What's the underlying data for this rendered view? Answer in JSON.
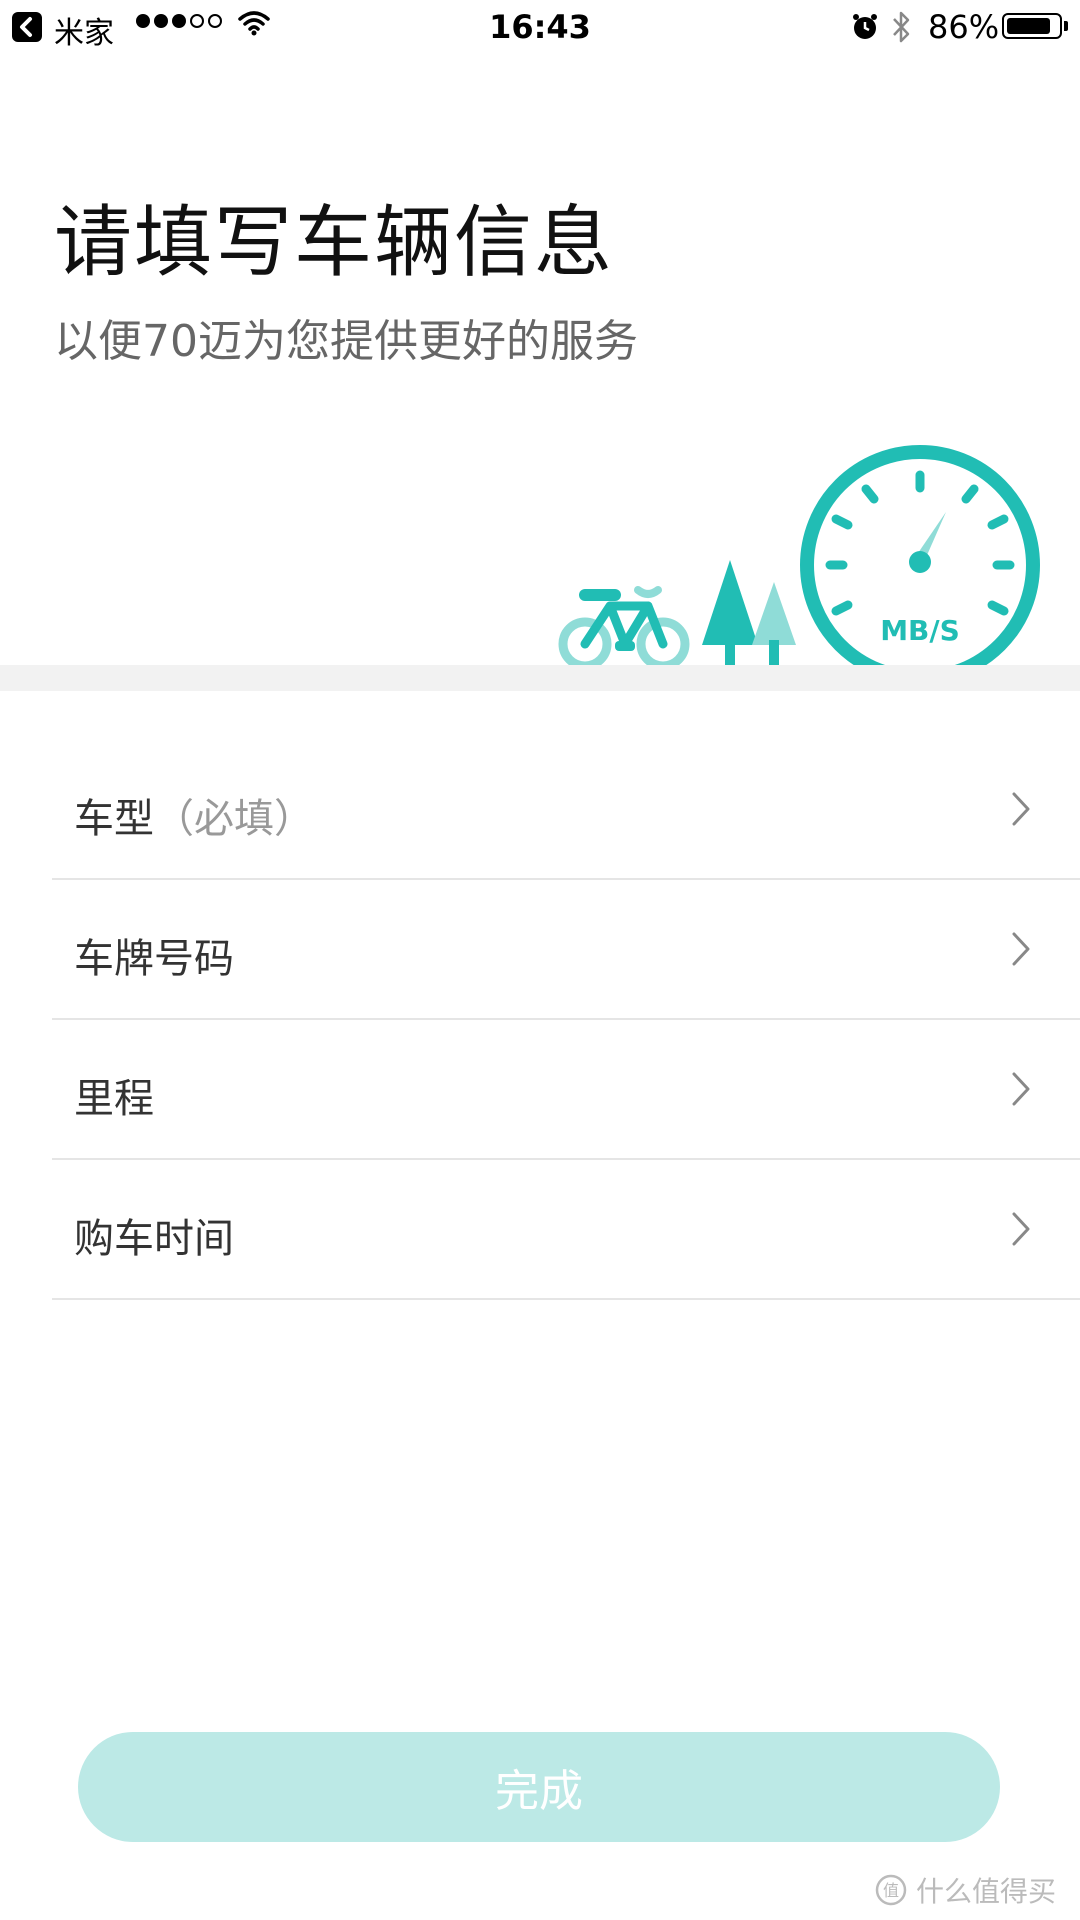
{
  "status_bar": {
    "app_name": "米家",
    "time": "16:43",
    "battery_pct": "86%",
    "battery_level": 0.86,
    "signal_bars_filled": 3,
    "signal_bars_total": 5
  },
  "header": {
    "title": "请填写车辆信息",
    "subtitle": "以便70迈为您提供更好的服务"
  },
  "illustration": {
    "gauge_label": "MB/S",
    "accent_color": "#21bdb4",
    "light_color": "#8fdcd7"
  },
  "list": {
    "items": [
      {
        "label": "车型",
        "hint": "（必填）"
      },
      {
        "label": "车牌号码",
        "hint": ""
      },
      {
        "label": "里程",
        "hint": ""
      },
      {
        "label": "购车时间",
        "hint": ""
      }
    ]
  },
  "footer": {
    "done_label": "完成",
    "watermark": "什么值得买"
  }
}
